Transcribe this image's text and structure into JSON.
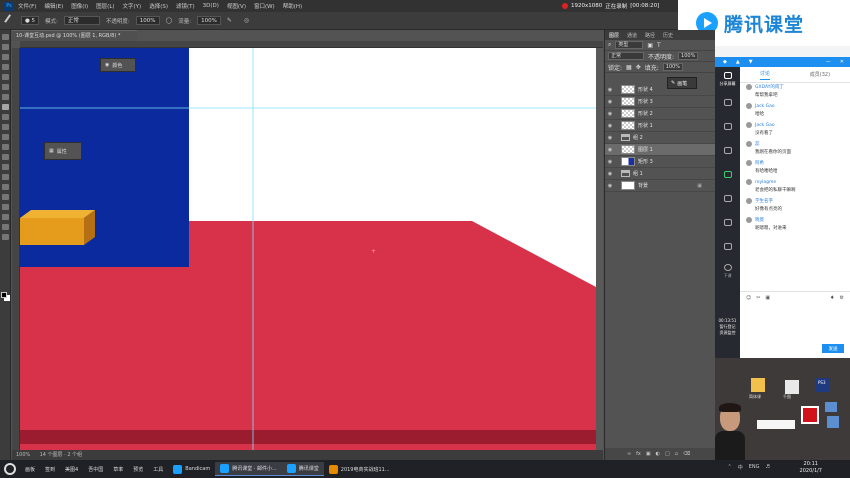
{
  "menu": [
    "文件(F)",
    "编辑(E)",
    "图像(I)",
    "图层(L)",
    "文字(Y)",
    "选择(S)",
    "滤镜(T)",
    "3D(D)",
    "视图(V)",
    "窗口(W)",
    "帮助(H)"
  ],
  "ps_logo": "Ps",
  "recording": {
    "resolution": "1920x1080",
    "status": "正在录制",
    "time": "[00:08:20]"
  },
  "options": {
    "mode_label": "模式:",
    "mode_value": "正常",
    "opacity_label": "不透明度:",
    "opacity_value": "100%",
    "flow_label": "流量:",
    "flow_value": "100%"
  },
  "document_tab": "10-课堂互动.psd @ 100% (图层 1, RGB/8) *",
  "canvas_colors": {
    "white": "#ffffff",
    "blue": "#0a2a9e",
    "red": "#d8324a",
    "dark_red": "#9c1c2f",
    "orange": "#e59b1c",
    "orange_dark": "#b47012",
    "guide": "#7fe0ff"
  },
  "floating_panels": {
    "color_label": "颜色",
    "props_label": "属性"
  },
  "status": {
    "zoom": "100%",
    "info": "14 个图层 · 2 个组"
  },
  "layers_panel": {
    "tabs": [
      "图层",
      "通道",
      "路径",
      "历史"
    ],
    "filter_value": "类型",
    "blend_value": "正常",
    "opacity_label": "不透明度:",
    "opacity_value": "100%",
    "lock_label": "锁定:",
    "fill_label": "填充:",
    "fill_value": "100%",
    "rows": [
      {
        "name": "形状 4",
        "kind": "checker",
        "selected": false,
        "lock": false
      },
      {
        "name": "形状 3",
        "kind": "checker",
        "selected": false,
        "lock": false
      },
      {
        "name": "形状 2",
        "kind": "checker",
        "selected": false,
        "lock": false
      },
      {
        "name": "形状 1",
        "kind": "checker",
        "selected": false,
        "lock": false
      },
      {
        "name": "组 2",
        "kind": "folder",
        "selected": false,
        "lock": false
      },
      {
        "name": "图层 1",
        "kind": "checker",
        "selected": true,
        "lock": false
      },
      {
        "name": "矩形 3",
        "kind": "blue",
        "selected": false,
        "lock": false
      },
      {
        "name": "组 1",
        "kind": "folder",
        "selected": false,
        "lock": false
      },
      {
        "name": "背景",
        "kind": "white",
        "selected": false,
        "lock": true
      }
    ],
    "brush_tooltip": "画笔"
  },
  "tencent": {
    "brand": "腾讯课堂",
    "nav": [
      "分享屏幕",
      "",
      "",
      "",
      "",
      "下课"
    ],
    "chat_tabs": [
      "讨论",
      "成员(32)"
    ],
    "messages": [
      {
        "user": "GXDAY的肉丁",
        "text": "帮帮我拿吧"
      },
      {
        "user": "Jack Gao",
        "text": "哈哈"
      },
      {
        "user": "Jack Gao",
        "text": "没有看了"
      },
      {
        "user": "蕊",
        "text": "我刚在看你的页面"
      },
      {
        "user": "阿希",
        "text": "有哈喽哈哈"
      },
      {
        "user": "roylagme",
        "text": "老会把的私聊干嘛啊"
      },
      {
        "user": "学生名字",
        "text": "好像有点亮的"
      },
      {
        "user": "晓莫",
        "text": "呢嗯嗯，对进来"
      }
    ],
    "send_label": "发送",
    "session_time": "00:13:51",
    "session_label": [
      "暂行登记",
      "资源监控"
    ]
  },
  "desktop": {
    "icons": [
      "简体课",
      "千图",
      "PS3"
    ]
  },
  "taskbar": {
    "items": [
      {
        "label": "画板",
        "active": false
      },
      {
        "label": "签到",
        "active": false
      },
      {
        "label": "美图4",
        "active": false
      },
      {
        "label": "吾中国",
        "active": false
      },
      {
        "label": "草率",
        "active": false
      },
      {
        "label": "预览",
        "active": false
      },
      {
        "label": "工具",
        "active": false
      },
      {
        "label": "Bandicam",
        "active": false
      },
      {
        "label": "腾讯课堂 · 邮件小...",
        "active": true
      },
      {
        "label": "腾讯课堂",
        "active": true
      },
      {
        "label": "2019电商实战班11...",
        "active": false
      }
    ],
    "tray": [
      "中",
      "ENG"
    ],
    "clock_time": "20:11",
    "clock_date": "2020/1/7"
  }
}
